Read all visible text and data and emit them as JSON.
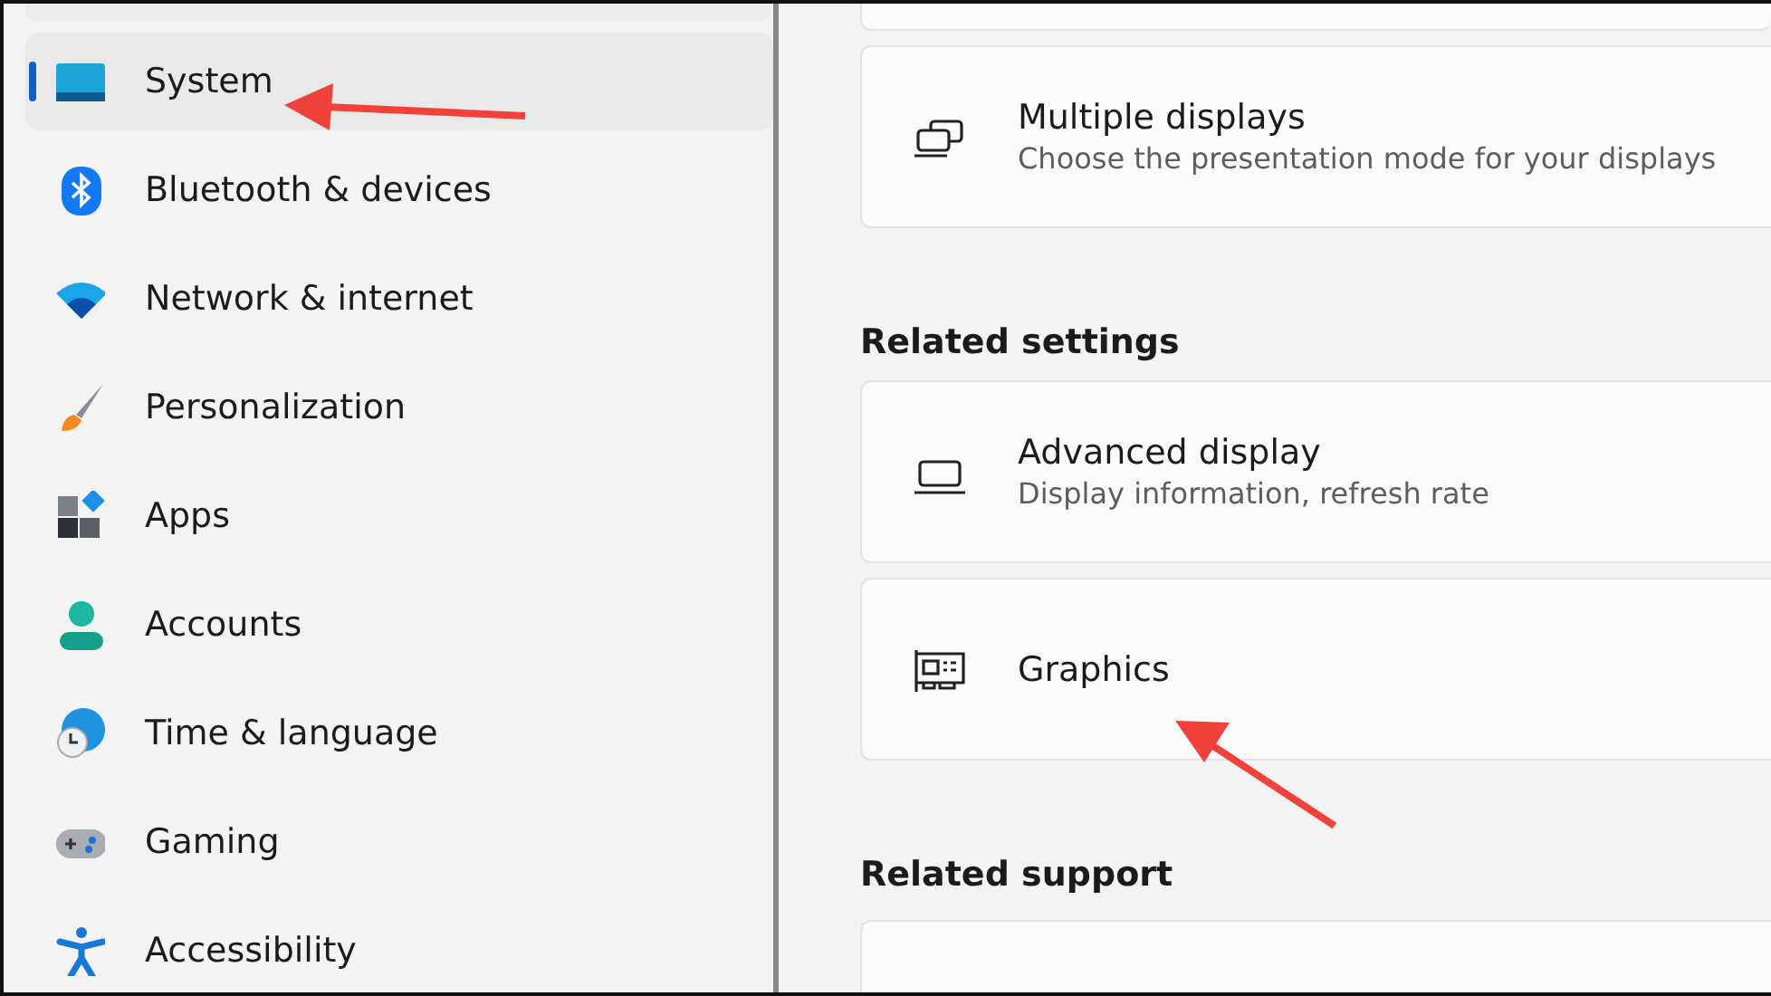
{
  "sidebar": {
    "items": [
      {
        "label": "System",
        "kind": "system",
        "selected": true
      },
      {
        "label": "Bluetooth & devices",
        "kind": "bluetooth",
        "selected": false
      },
      {
        "label": "Network & internet",
        "kind": "network",
        "selected": false
      },
      {
        "label": "Personalization",
        "kind": "personalization",
        "selected": false
      },
      {
        "label": "Apps",
        "kind": "apps",
        "selected": false
      },
      {
        "label": "Accounts",
        "kind": "accounts",
        "selected": false
      },
      {
        "label": "Time & language",
        "kind": "time",
        "selected": false
      },
      {
        "label": "Gaming",
        "kind": "gaming",
        "selected": false
      },
      {
        "label": "Accessibility",
        "kind": "accessibility",
        "selected": false
      }
    ]
  },
  "main": {
    "cards": [
      {
        "kind": "displays",
        "title": "Multiple displays",
        "subtitle": "Choose the presentation mode for your displays"
      }
    ],
    "sections": [
      {
        "heading": "Related settings",
        "cards": [
          {
            "kind": "laptop",
            "title": "Advanced display",
            "subtitle": "Display information, refresh rate"
          },
          {
            "kind": "gpu",
            "title": "Graphics"
          }
        ]
      },
      {
        "heading": "Related support"
      }
    ]
  }
}
